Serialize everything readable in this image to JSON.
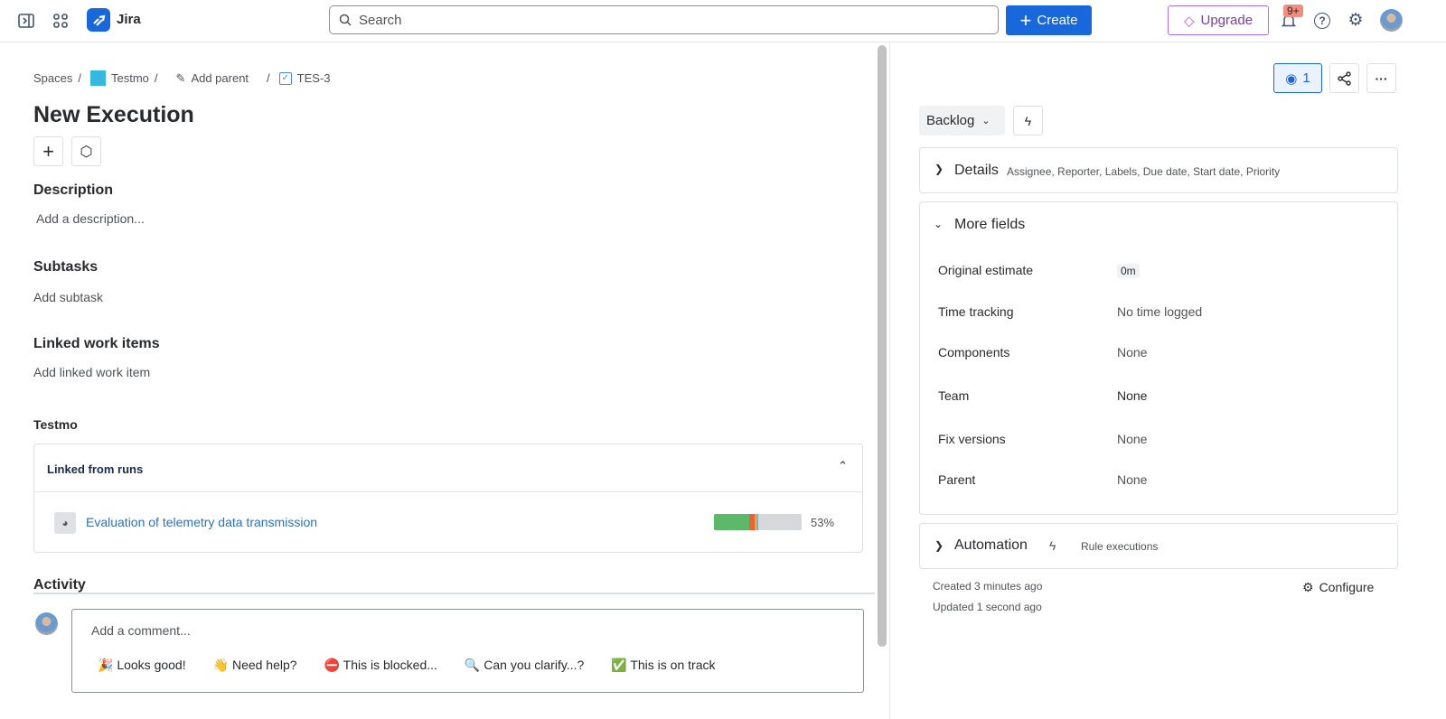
{
  "topbar": {
    "app_name": "Jira",
    "search_placeholder": "Search",
    "create_label": "Create",
    "upgrade_label": "Upgrade",
    "notification_badge": "9+"
  },
  "breadcrumb": {
    "spaces": "Spaces",
    "project": "Testmo",
    "add_parent": "Add parent",
    "issue_key": "TES-3"
  },
  "issue": {
    "title": "New Execution"
  },
  "description": {
    "heading": "Description",
    "placeholder": "Add a description..."
  },
  "subtasks": {
    "heading": "Subtasks",
    "add": "Add subtask"
  },
  "linked": {
    "heading": "Linked work items",
    "add": "Add linked work item"
  },
  "testmo": {
    "heading": "Testmo",
    "panel_title": "Linked from runs",
    "runs": [
      {
        "name": "Evaluation of telemetry data transmission",
        "progress_label": "53%",
        "segments": [
          {
            "color": "#5cb96a",
            "pct": 40
          },
          {
            "color": "#e8653a",
            "pct": 6
          },
          {
            "color": "#f0a63a",
            "pct": 3
          },
          {
            "color": "#6aa9d8",
            "pct": 2
          },
          {
            "color": "#d6d8db",
            "pct": 49
          }
        ]
      }
    ]
  },
  "activity": {
    "heading": "Activity",
    "comment_placeholder": "Add a comment...",
    "quick_replies": [
      {
        "emoji": "🎉",
        "label": "Looks good!"
      },
      {
        "emoji": "👋",
        "label": "Need help?"
      },
      {
        "emoji": "⛔",
        "label": "This is blocked..."
      },
      {
        "emoji": "🔍",
        "label": "Can you clarify...?"
      },
      {
        "emoji": "✅",
        "label": "This is on track"
      }
    ]
  },
  "sidebar": {
    "watch_count": "1",
    "status": "Backlog",
    "details": {
      "title": "Details",
      "summary": "Assignee, Reporter, Labels, Due date, Start date, Priority"
    },
    "more_fields": {
      "title": "More fields",
      "fields": [
        {
          "label": "Original estimate",
          "value": "0m"
        },
        {
          "label": "Time tracking",
          "value": "No time logged"
        },
        {
          "label": "Components",
          "value": "None"
        },
        {
          "label": "Team",
          "value": "None"
        },
        {
          "label": "Fix versions",
          "value": "None"
        },
        {
          "label": "Parent",
          "value": "None"
        }
      ]
    },
    "automation": {
      "title": "Automation",
      "subtitle": "Rule executions"
    },
    "created": "Created 3 minutes ago",
    "updated": "Updated 1 second ago",
    "configure": "Configure"
  }
}
